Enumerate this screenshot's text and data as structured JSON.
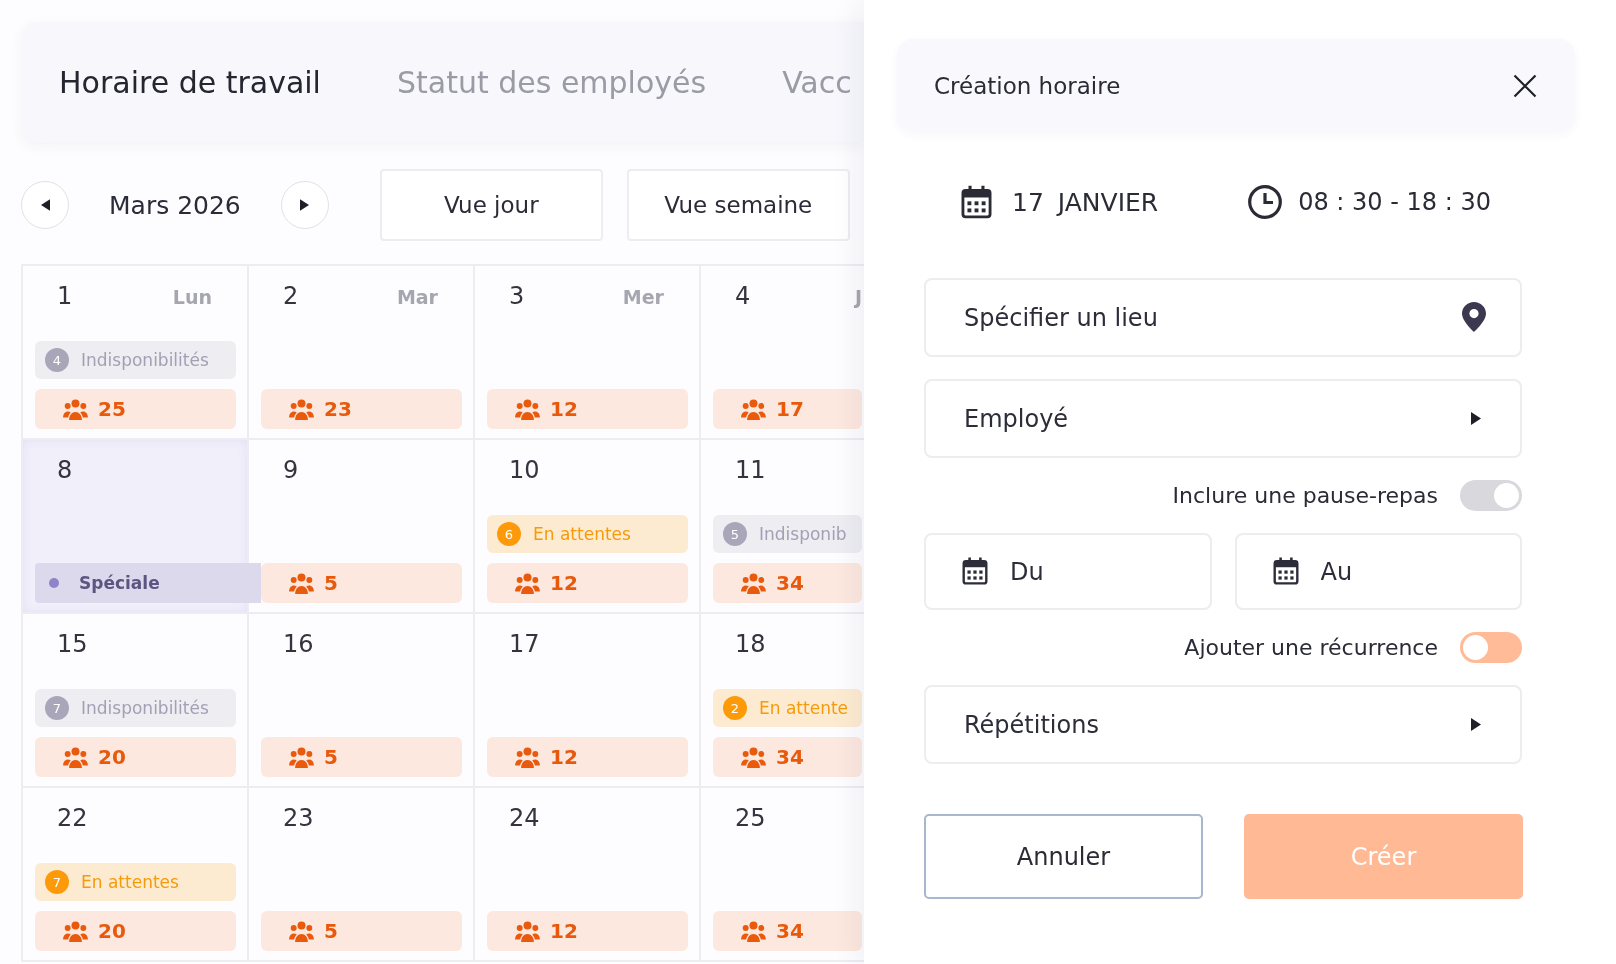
{
  "tabs": [
    {
      "label": "Horaire de travail",
      "selected": true
    },
    {
      "label": "Statut des employés",
      "selected": false
    },
    {
      "label": "Vacc",
      "selected": false
    }
  ],
  "calendar": {
    "month": "Mars 2026",
    "views": [
      {
        "label": "Vue jour",
        "selected": false
      },
      {
        "label": "Vue semaine",
        "selected": false
      }
    ],
    "weeks": [
      {
        "days": [
          {
            "date": "1",
            "weekday": "Lun",
            "selected": false,
            "events": [
              {
                "kind": "unavailable",
                "count": "4",
                "label": "Indisponibilités"
              },
              {
                "kind": "staff",
                "count": "25"
              }
            ]
          },
          {
            "date": "2",
            "weekday": "Mar",
            "selected": false,
            "events": [
              {
                "kind": "staff",
                "count": "23"
              }
            ]
          },
          {
            "date": "3",
            "weekday": "Mer",
            "selected": false,
            "events": [
              {
                "kind": "staff",
                "count": "12"
              }
            ]
          },
          {
            "date": "4",
            "weekday": "J",
            "selected": false,
            "events": [
              {
                "kind": "staff",
                "count": "17"
              }
            ]
          }
        ]
      },
      {
        "days": [
          {
            "date": "8",
            "selected": true,
            "events": [
              {
                "kind": "special",
                "label": "Spéciale"
              }
            ]
          },
          {
            "date": "9",
            "selected": false,
            "events": [
              {
                "kind": "staff",
                "count": "5"
              }
            ]
          },
          {
            "date": "10",
            "selected": false,
            "events": [
              {
                "kind": "pending",
                "count": "6",
                "label": "En attentes"
              },
              {
                "kind": "staff",
                "count": "12"
              }
            ]
          },
          {
            "date": "11",
            "selected": false,
            "events": [
              {
                "kind": "unavailable",
                "count": "5",
                "label": "Indisponib"
              },
              {
                "kind": "staff",
                "count": "34"
              }
            ]
          }
        ]
      },
      {
        "days": [
          {
            "date": "15",
            "selected": false,
            "events": [
              {
                "kind": "unavailable",
                "count": "7",
                "label": "Indisponibilités"
              },
              {
                "kind": "staff",
                "count": "20"
              }
            ]
          },
          {
            "date": "16",
            "selected": false,
            "events": [
              {
                "kind": "staff",
                "count": "5"
              }
            ]
          },
          {
            "date": "17",
            "selected": false,
            "events": [
              {
                "kind": "staff",
                "count": "12"
              }
            ]
          },
          {
            "date": "18",
            "selected": false,
            "events": [
              {
                "kind": "pending",
                "count": "2",
                "label": "En attente"
              },
              {
                "kind": "staff",
                "count": "34"
              }
            ]
          }
        ]
      },
      {
        "days": [
          {
            "date": "22",
            "selected": false,
            "events": [
              {
                "kind": "pending",
                "count": "7",
                "label": "En attentes"
              },
              {
                "kind": "staff",
                "count": "20"
              }
            ]
          },
          {
            "date": "23",
            "selected": false,
            "events": [
              {
                "kind": "staff",
                "count": "5"
              }
            ]
          },
          {
            "date": "24",
            "selected": false,
            "events": [
              {
                "kind": "staff",
                "count": "12"
              }
            ]
          },
          {
            "date": "25",
            "selected": false,
            "events": [
              {
                "kind": "staff",
                "count": "34"
              }
            ]
          }
        ]
      }
    ]
  },
  "panel": {
    "title": "Création horaire",
    "date": {
      "day": "17",
      "month": "JANVIER"
    },
    "time": "08 : 30 - 18 : 30",
    "form": [
      {
        "kind": "location",
        "placeholder": "Spécifier un lieu"
      },
      {
        "kind": "select",
        "label": "Employé"
      },
      {
        "kind": "toggle",
        "label": "Inclure une pause-repas",
        "on": true,
        "disabled": true
      },
      {
        "kind": "dates",
        "from": {
          "placeholder": "Du"
        },
        "to": {
          "placeholder": "Au"
        }
      },
      {
        "kind": "toggle",
        "label": "Ajouter une récurrence",
        "on": false,
        "disabled": false
      },
      {
        "kind": "select",
        "label": "Répétitions"
      }
    ],
    "buttons": [
      {
        "kind": "secondary",
        "label": "Annuler"
      },
      {
        "kind": "primary",
        "label": "Créer"
      }
    ]
  }
}
